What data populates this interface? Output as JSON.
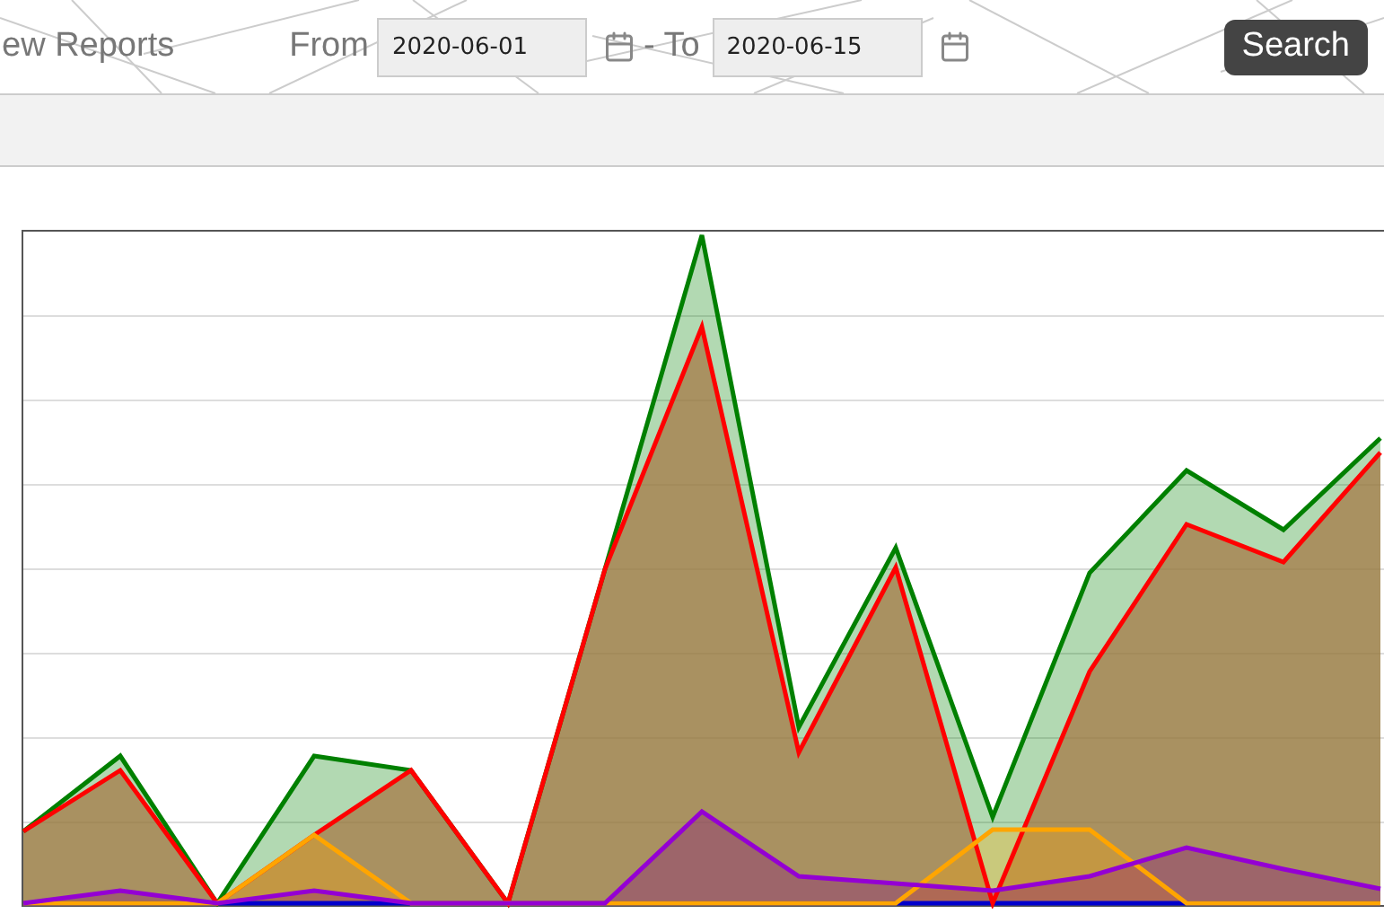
{
  "header": {
    "title": "ew Reports",
    "from_label": "From",
    "from_value": "2020-06-01",
    "to_label": "- To",
    "to_value": "2020-06-15",
    "search_button": "Search"
  }
}
